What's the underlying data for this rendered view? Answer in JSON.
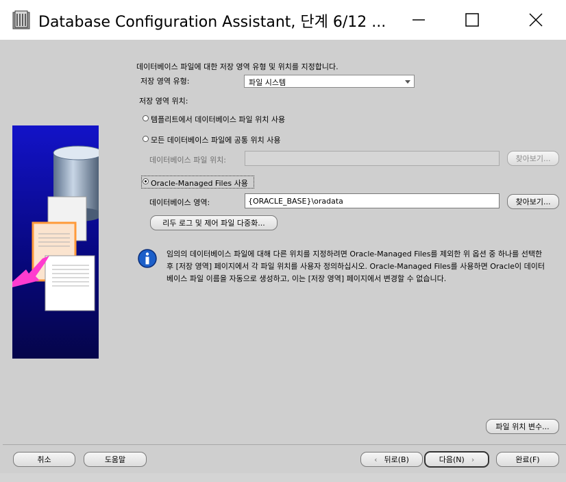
{
  "window": {
    "title": "Database Configuration Assistant, 단계 6/12 ...",
    "controls": {
      "minimize": "minimize-icon",
      "maximize": "maximize-icon",
      "close": "close-icon"
    }
  },
  "main": {
    "heading": "데이터베이스 파일에 대한 저장 영역 유형 및 위치를 지정합니다.",
    "storage_type_label": "저장 영역 유형:",
    "storage_type_value": "파일 시스템",
    "storage_location_label": "저장 영역 위치:",
    "options": {
      "template": {
        "label": "템플리트에서 데이터베이스 파일 위치 사용",
        "selected": false
      },
      "common": {
        "label": "모든 데이터베이스 파일에 공통 위치 사용",
        "selected": false
      },
      "omf": {
        "label": "Oracle-Managed Files 사용",
        "selected": true
      }
    },
    "db_file_location_label": "데이터베이스 파일 위치:",
    "db_file_location_value": "",
    "db_area_label": "데이터베이스 영역:",
    "db_area_value": "{ORACLE_BASE}\\oradata",
    "browse_label": "찾아보기...",
    "multiplex_button": "리두 로그 및 제어 파일 다중화...",
    "info_text": "임의의 데이터베이스 파일에 대해 다른 위치를 지정하려면 Oracle-Managed Files를 제외한 위 옵션 중 하나를 선택한 후 [저장 영역] 페이지에서 각 파일 위치를 사용자 정의하십시오. Oracle-Managed Files를 사용하면 Oracle이 데이터베이스 파일 이름을 자동으로 생성하고, 이는 [저장 영역] 페이지에서 변경할 수 없습니다.",
    "file_location_vars_button": "파일 위치 변수..."
  },
  "footer": {
    "cancel": "취소",
    "help": "도움말",
    "back": "뒤로(B)",
    "next": "다음(N)",
    "finish": "완료(F)"
  },
  "colors": {
    "panel_blue": "#07077a",
    "arrow_magenta": "#ff3ccf",
    "info_blue": "#1c5fc9",
    "background": "#cfcfcf"
  }
}
